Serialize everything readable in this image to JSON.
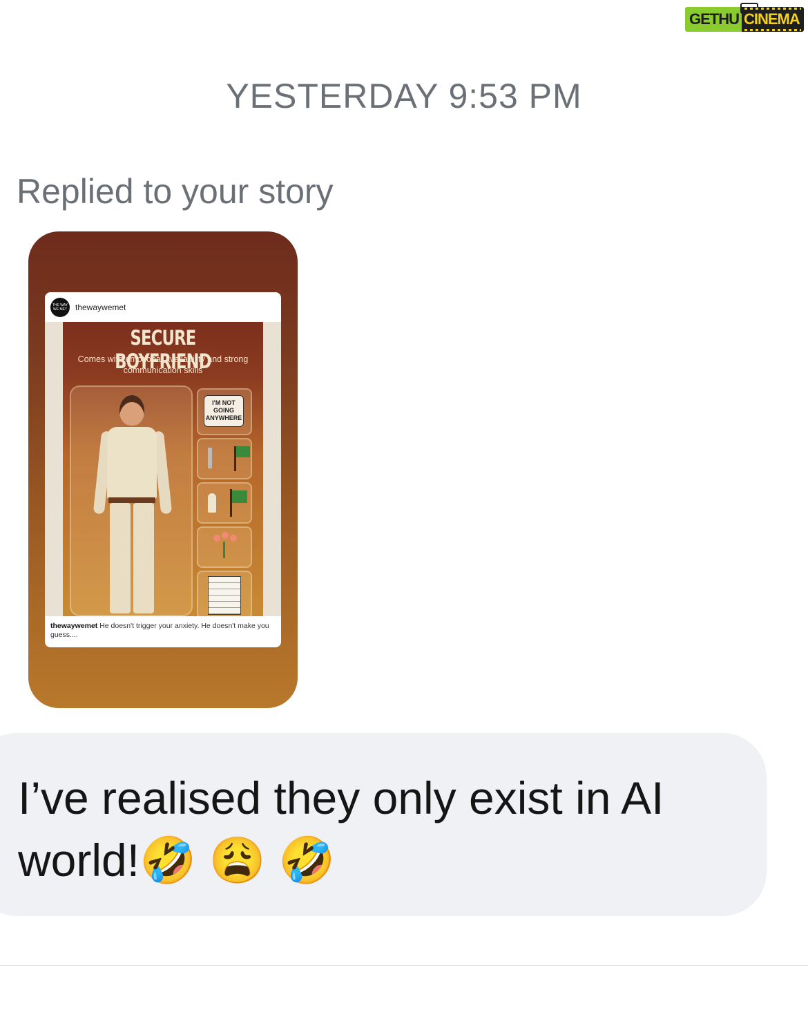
{
  "watermark": {
    "left": "GETHU",
    "right": "CINEMA"
  },
  "thread": {
    "timestamp": "YESTERDAY 9:53 PM",
    "reply_label": "Replied to your story",
    "story": {
      "username": "thewaywemet",
      "avatar_text": "THE WAY WE MET",
      "title": "SECURE BOYFRIEND",
      "subtitle": "Comes with emotional availability and strong communication skills",
      "speech_bubble": "I'M NOT GOING ANYWHERE",
      "caption_user": "thewaywemet",
      "caption_text": "He doesn't trigger your anxiety. He doesn't make you guess...."
    },
    "message": {
      "text": "I’ve realised they only exist in AI world!🤣 😩 🤣"
    }
  }
}
